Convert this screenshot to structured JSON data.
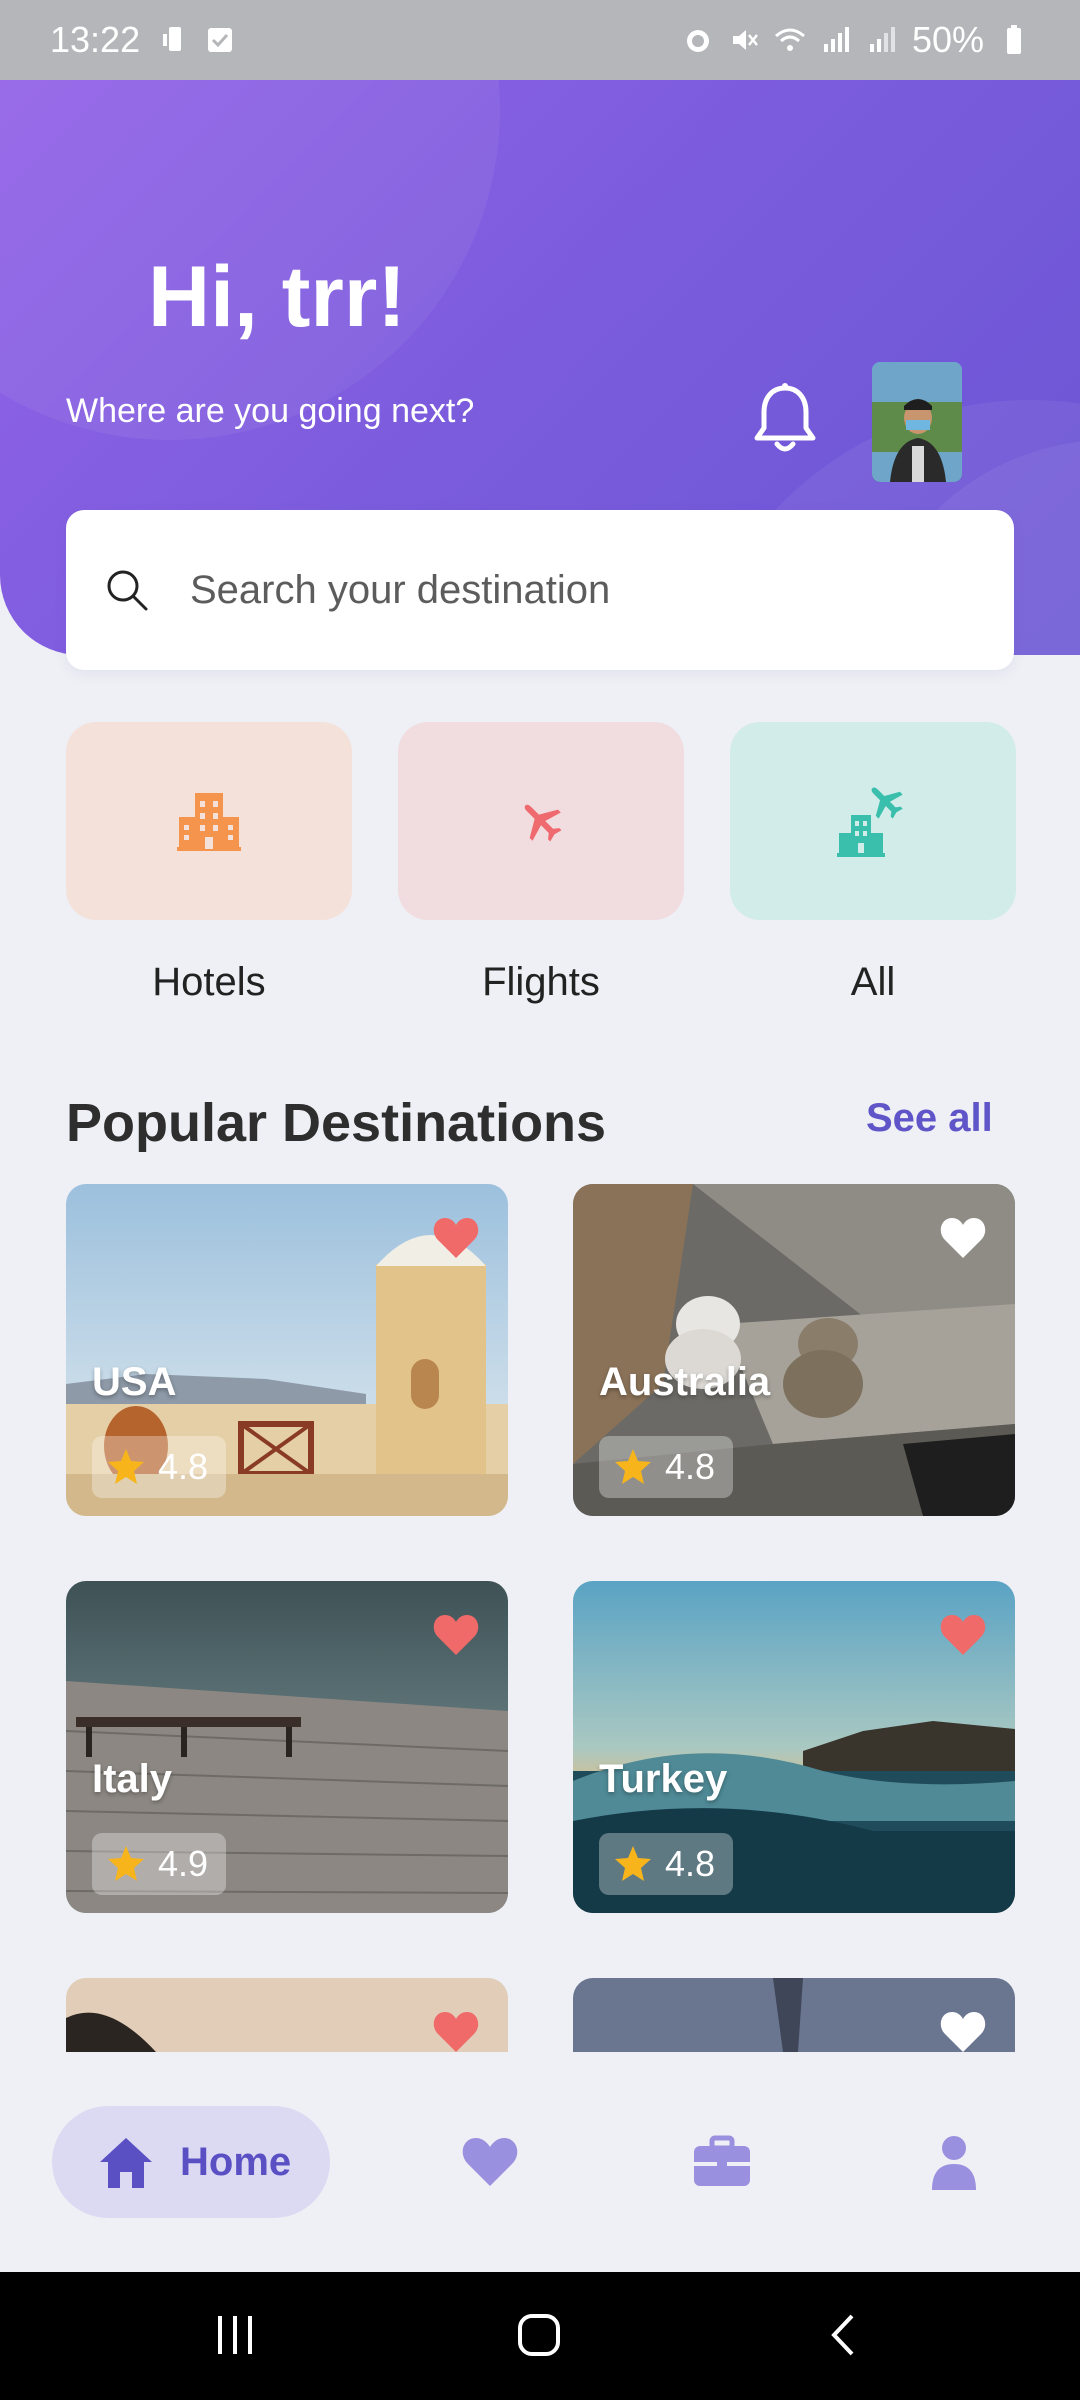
{
  "status_bar": {
    "time": "13:22",
    "battery": "50%"
  },
  "header": {
    "greeting": "Hi, trr!",
    "subtitle": "Where are you going next?"
  },
  "search": {
    "placeholder": "Search your destination"
  },
  "categories": [
    {
      "label": "Hotels",
      "icon": "hotel-icon",
      "bg": "#f4e2da",
      "color": "#f5944c"
    },
    {
      "label": "Flights",
      "icon": "plane-icon",
      "bg": "#f1dce0",
      "color": "#ef6a6f"
    },
    {
      "label": "All",
      "icon": "hotel-plane-icon",
      "bg": "#d2ecea",
      "color": "#3bbfad"
    }
  ],
  "popular": {
    "title": "Popular Destinations",
    "see_all": "See all",
    "destinations": [
      {
        "name": "USA",
        "rating": "4.8",
        "favorited": true
      },
      {
        "name": "Australia",
        "rating": "4.8",
        "favorited": false
      },
      {
        "name": "Italy",
        "rating": "4.9",
        "favorited": true
      },
      {
        "name": "Turkey",
        "rating": "4.8",
        "favorited": true
      },
      {
        "name": "",
        "rating": "",
        "favorited": true
      },
      {
        "name": "",
        "rating": "",
        "favorited": false
      }
    ]
  },
  "bottom_nav": {
    "home_label": "Home",
    "items": [
      "home-icon",
      "heart-icon",
      "briefcase-icon",
      "profile-icon"
    ]
  },
  "colors": {
    "accent": "#5f55c8",
    "header_gradient_start": "#9362e8",
    "header_gradient_end": "#6a55d4",
    "heart_red": "#f06a6a",
    "star": "#f7b51b"
  }
}
